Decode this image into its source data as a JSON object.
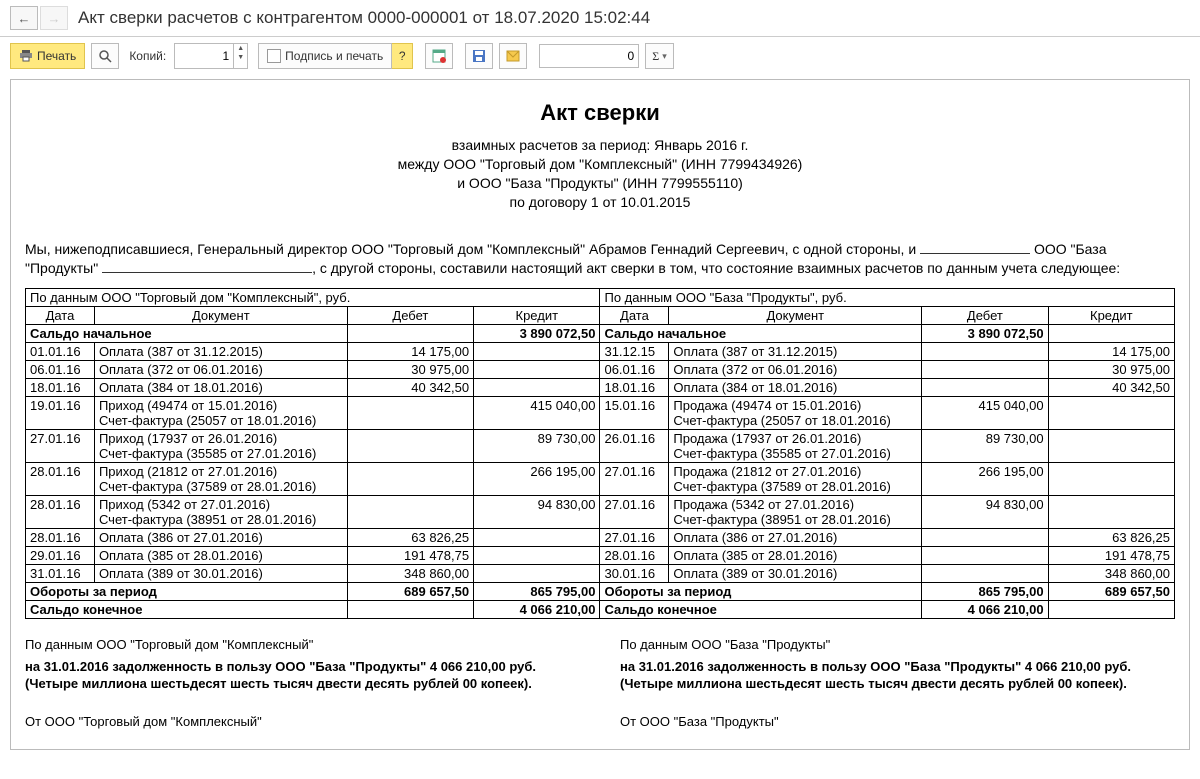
{
  "window": {
    "title": "Акт сверки расчетов с контрагентом 0000-000001 от 18.07.2020 15:02:44"
  },
  "toolbar": {
    "print": "Печать",
    "copiesLabel": "Копий:",
    "copiesValue": "1",
    "signAndPrint": "Подпись и печать",
    "question": "?",
    "numField": "0",
    "sigma": "Σ",
    "sigmaDropdown": "▾"
  },
  "doc": {
    "title": "Акт сверки",
    "sub1": "взаимных расчетов за период: Январь 2016 г.",
    "sub2": "между ООО \"Торговый дом \"Комплексный\" (ИНН 7799434926)",
    "sub3": "и ООО \"База \"Продукты\" (ИНН 7799555110)",
    "sub4": "по договору 1 от 10.01.2015",
    "preamble1": "Мы, нижеподписавшиеся, Генеральный директор ООО \"Торговый дом \"Комплексный\" Абрамов Геннадий Сергеевич, с одной стороны, и ",
    "preamble2": " ООО \"База \"Продукты\" ",
    "preamble3": ", с другой стороны, составили настоящий акт сверки в том, что состояние взаимных расчетов по данным учета следующее:"
  },
  "table": {
    "headL": "По данным ООО \"Торговый дом \"Комплексный\", руб.",
    "headR": "По данным ООО \"База \"Продукты\", руб.",
    "colDate": "Дата",
    "colDoc": "Документ",
    "colDebit": "Дебет",
    "colCredit": "Кредит",
    "openBal": "Сальдо начальное",
    "openBalVal": "3 890 072,50",
    "turnover": "Обороты за период",
    "closeBal": "Сальдо конечное",
    "rowsL": [
      {
        "d": "01.01.16",
        "doc": "Оплата (387 от 31.12.2015)",
        "db": "14 175,00",
        "cr": ""
      },
      {
        "d": "06.01.16",
        "doc": "Оплата (372 от 06.01.2016)",
        "db": "30 975,00",
        "cr": ""
      },
      {
        "d": "18.01.16",
        "doc": "Оплата (384 от 18.01.2016)",
        "db": "40 342,50",
        "cr": ""
      },
      {
        "d": "19.01.16",
        "doc": "Приход (49474 от 15.01.2016)\nСчет-фактура (25057 от 18.01.2016)",
        "db": "",
        "cr": "415 040,00"
      },
      {
        "d": "27.01.16",
        "doc": "Приход (17937 от 26.01.2016)\nСчет-фактура (35585 от 27.01.2016)",
        "db": "",
        "cr": "89 730,00"
      },
      {
        "d": "28.01.16",
        "doc": "Приход (21812 от 27.01.2016)\nСчет-фактура (37589 от 28.01.2016)",
        "db": "",
        "cr": "266 195,00"
      },
      {
        "d": "28.01.16",
        "doc": "Приход (5342 от 27.01.2016)\nСчет-фактура (38951 от 28.01.2016)",
        "db": "",
        "cr": "94 830,00"
      },
      {
        "d": "28.01.16",
        "doc": "Оплата (386 от 27.01.2016)",
        "db": "63 826,25",
        "cr": ""
      },
      {
        "d": "29.01.16",
        "doc": "Оплата (385 от 28.01.2016)",
        "db": "191 478,75",
        "cr": ""
      },
      {
        "d": "31.01.16",
        "doc": "Оплата (389 от 30.01.2016)",
        "db": "348 860,00",
        "cr": ""
      }
    ],
    "rowsR": [
      {
        "d": "31.12.15",
        "doc": "Оплата (387 от 31.12.2015)",
        "db": "",
        "cr": "14 175,00"
      },
      {
        "d": "06.01.16",
        "doc": "Оплата (372 от 06.01.2016)",
        "db": "",
        "cr": "30 975,00"
      },
      {
        "d": "18.01.16",
        "doc": "Оплата (384 от 18.01.2016)",
        "db": "",
        "cr": "40 342,50"
      },
      {
        "d": "15.01.16",
        "doc": "Продажа (49474 от 15.01.2016)\nСчет-фактура (25057 от 18.01.2016)",
        "db": "415 040,00",
        "cr": ""
      },
      {
        "d": "26.01.16",
        "doc": "Продажа (17937 от 26.01.2016)\nСчет-фактура (35585 от 27.01.2016)",
        "db": "89 730,00",
        "cr": ""
      },
      {
        "d": "27.01.16",
        "doc": "Продажа (21812 от 27.01.2016)\nСчет-фактура (37589 от 28.01.2016)",
        "db": "266 195,00",
        "cr": ""
      },
      {
        "d": "27.01.16",
        "doc": "Продажа (5342 от 27.01.2016)\nСчет-фактура (38951 от 28.01.2016)",
        "db": "94 830,00",
        "cr": ""
      },
      {
        "d": "27.01.16",
        "doc": "Оплата (386 от 27.01.2016)",
        "db": "",
        "cr": "63 826,25"
      },
      {
        "d": "28.01.16",
        "doc": "Оплата (385 от 28.01.2016)",
        "db": "",
        "cr": "191 478,75"
      },
      {
        "d": "30.01.16",
        "doc": "Оплата (389 от 30.01.2016)",
        "db": "",
        "cr": "348 860,00"
      }
    ],
    "turnL": {
      "db": "689 657,50",
      "cr": "865 795,00"
    },
    "turnR": {
      "db": "865 795,00",
      "cr": "689 657,50"
    },
    "closeVal": "4 066 210,00"
  },
  "footer": {
    "leftHd": "По данным ООО \"Торговый дом \"Комплексный\"",
    "rightHd": "По данным ООО \"База \"Продукты\"",
    "leftSum": "на 31.01.2016 задолженность в пользу ООО \"База \"Продукты\" 4 066 210,00 руб. (Четыре миллиона шестьдесят шесть тысяч двести десять рублей 00 копеек).",
    "rightSum": "на 31.01.2016 задолженность в пользу ООО \"База \"Продукты\" 4 066 210,00 руб. (Четыре миллиона шестьдесят шесть тысяч двести десять рублей 00 копеек).",
    "sigL": "От ООО \"Торговый дом \"Комплексный\"",
    "sigR": "От ООО \"База \"Продукты\""
  }
}
